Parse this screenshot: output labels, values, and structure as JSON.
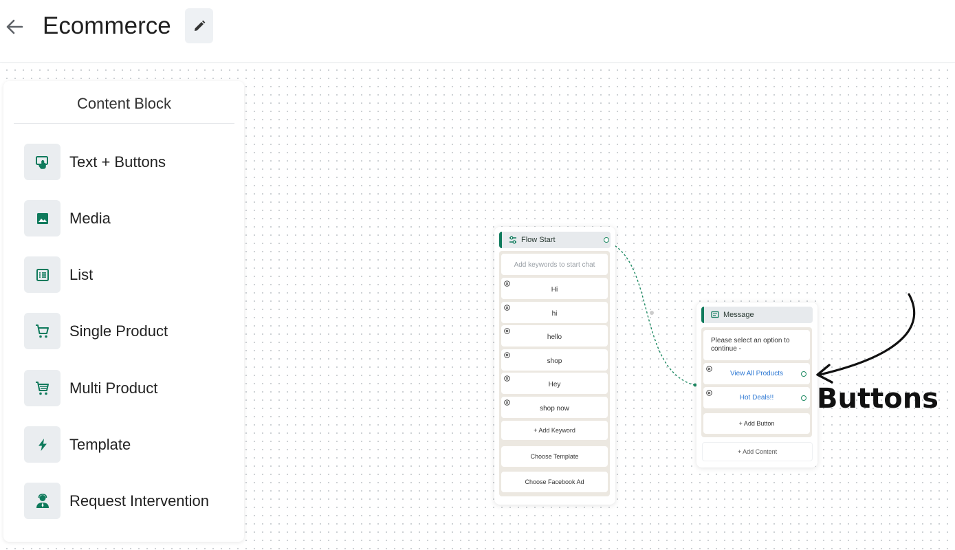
{
  "header": {
    "title": "Ecommerce"
  },
  "panel": {
    "title": "Content Block",
    "items": [
      {
        "label": "Text + Buttons",
        "icon": "touch-screen-icon"
      },
      {
        "label": "Media",
        "icon": "image-icon"
      },
      {
        "label": "List",
        "icon": "list-icon"
      },
      {
        "label": "Single Product",
        "icon": "cart-icon"
      },
      {
        "label": "Multi Product",
        "icon": "multi-cart-icon"
      },
      {
        "label": "Template",
        "icon": "bolt-icon"
      },
      {
        "label": "Request Intervention",
        "icon": "agent-icon"
      }
    ]
  },
  "flow_start": {
    "title": "Flow Start",
    "keyword_placeholder": "Add keywords to start chat",
    "keywords": [
      "Hi",
      "hi",
      "hello",
      "shop",
      "Hey",
      "shop now"
    ],
    "add_keyword": "+ Add Keyword",
    "choose_template": "Choose Template",
    "choose_facebook_ad": "Choose Facebook Ad"
  },
  "message": {
    "title": "Message",
    "text": "Please select an option to continue -",
    "buttons": [
      "View All Products",
      "Hot Deals!!"
    ],
    "add_button": "+ Add Button",
    "add_content": "+ Add Content"
  },
  "annotation": {
    "label": "Buttons"
  },
  "colors": {
    "accent": "#0f7a5c",
    "link": "#2a76d2",
    "node_body": "#ece8e1"
  }
}
